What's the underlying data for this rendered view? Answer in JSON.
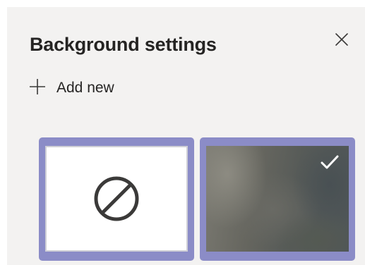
{
  "panel": {
    "title": "Background settings",
    "close_icon": "close-icon",
    "add_new_label": "Add new",
    "add_icon": "plus-icon"
  },
  "backgrounds": [
    {
      "id": "none",
      "icon": "no-background-icon",
      "selected": false
    },
    {
      "id": "blur",
      "icon": "checkmark-icon",
      "selected": true
    }
  ],
  "colors": {
    "panel_bg": "#f3f2f1",
    "accent": "#8b8cc7",
    "text": "#252423"
  }
}
